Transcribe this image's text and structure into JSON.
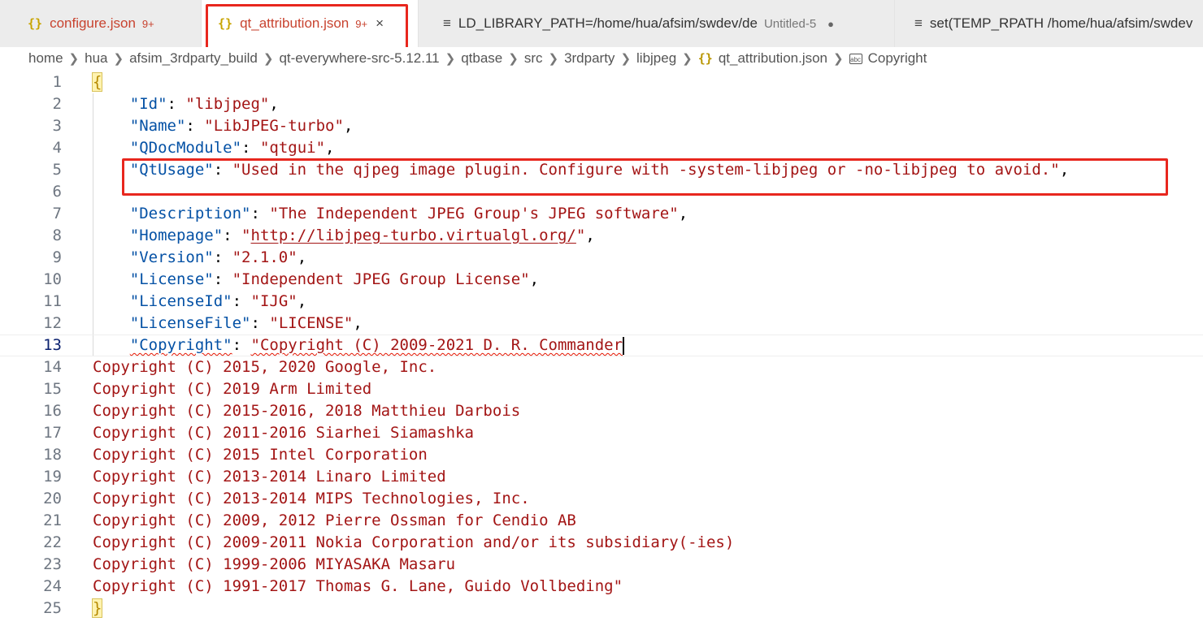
{
  "tabs": [
    {
      "icon": "{}",
      "name": "configure.json",
      "count": "9+",
      "active": false,
      "error": true
    },
    {
      "icon": "{}",
      "name": "qt_attribution.json",
      "count": "9+",
      "active": true,
      "error": true,
      "close": "×"
    },
    {
      "name": "LD_LIBRARY_PATH=/home/hua/afsim/swdev/de",
      "desc": "Untitled-5",
      "dirty": "●"
    },
    {
      "name": "set(TEMP_RPATH /home/hua/afsim/swdev"
    }
  ],
  "breadcrumb": [
    "home",
    "hua",
    "afsim_3rdparty_build",
    "qt-everywhere-src-5.12.11",
    "qtbase",
    "src",
    "3rdparty",
    "libjpeg",
    "qt_attribution.json",
    "Copyright"
  ],
  "editor": {
    "line_numbers": [
      "1",
      "2",
      "3",
      "4",
      "5",
      "6",
      "7",
      "8",
      "9",
      "10",
      "11",
      "12",
      "13",
      "14",
      "15",
      "16",
      "17",
      "18",
      "19",
      "20",
      "21",
      "22",
      "23",
      "24",
      "25"
    ],
    "open_brace": "{",
    "close_brace": "}",
    "entries": [
      {
        "key": "\"Id\"",
        "value": "\"libjpeg\""
      },
      {
        "key": "\"Name\"",
        "value": "\"LibJPEG-turbo\""
      },
      {
        "key": "\"QDocModule\"",
        "value": "\"qtgui\""
      },
      {
        "key": "\"QtUsage\"",
        "value": "\"Used in the qjpeg image plugin. Configure with -system-libjpeg or -no-libjpeg to avoid.\""
      },
      {
        "key": "\"Description\"",
        "value": "\"The Independent JPEG Group's JPEG software\""
      },
      {
        "key": "\"Homepage\"",
        "value_quote": "\"",
        "value_link": "http://libjpeg-turbo.virtualgl.org/"
      },
      {
        "key": "\"Version\"",
        "value": "\"2.1.0\""
      },
      {
        "key": "\"License\"",
        "value": "\"Independent JPEG Group License\""
      },
      {
        "key": "\"LicenseId\"",
        "value": "\"IJG\""
      },
      {
        "key": "\"LicenseFile\"",
        "value": "\"LICENSE\""
      },
      {
        "key": "\"Copyright\"",
        "value": "\"Copyright (C) 2009-2021 D. R. Commander"
      }
    ],
    "colon": ": ",
    "comma": ",",
    "indent": "    ",
    "copyright_lines": [
      "Copyright (C) 2015, 2020 Google, Inc.",
      "Copyright (C) 2019 Arm Limited",
      "Copyright (C) 2015-2016, 2018 Matthieu Darbois",
      "Copyright (C) 2011-2016 Siarhei Siamashka",
      "Copyright (C) 2015 Intel Corporation",
      "Copyright (C) 2013-2014 Linaro Limited",
      "Copyright (C) 2013-2014 MIPS Technologies, Inc.",
      "Copyright (C) 2009, 2012 Pierre Ossman for Cendio AB",
      "Copyright (C) 2009-2011 Nokia Corporation and/or its subsidiary(-ies)",
      "Copyright (C) 1999-2006 MIYASAKA Masaru",
      "Copyright (C) 1991-2017 Thomas G. Lane, Guido Vollbeding\""
    ]
  },
  "colors": {
    "error": "#c8432f",
    "json_key": "#0451a5",
    "json_string": "#a31515",
    "highlight_box": "#e8271e"
  }
}
